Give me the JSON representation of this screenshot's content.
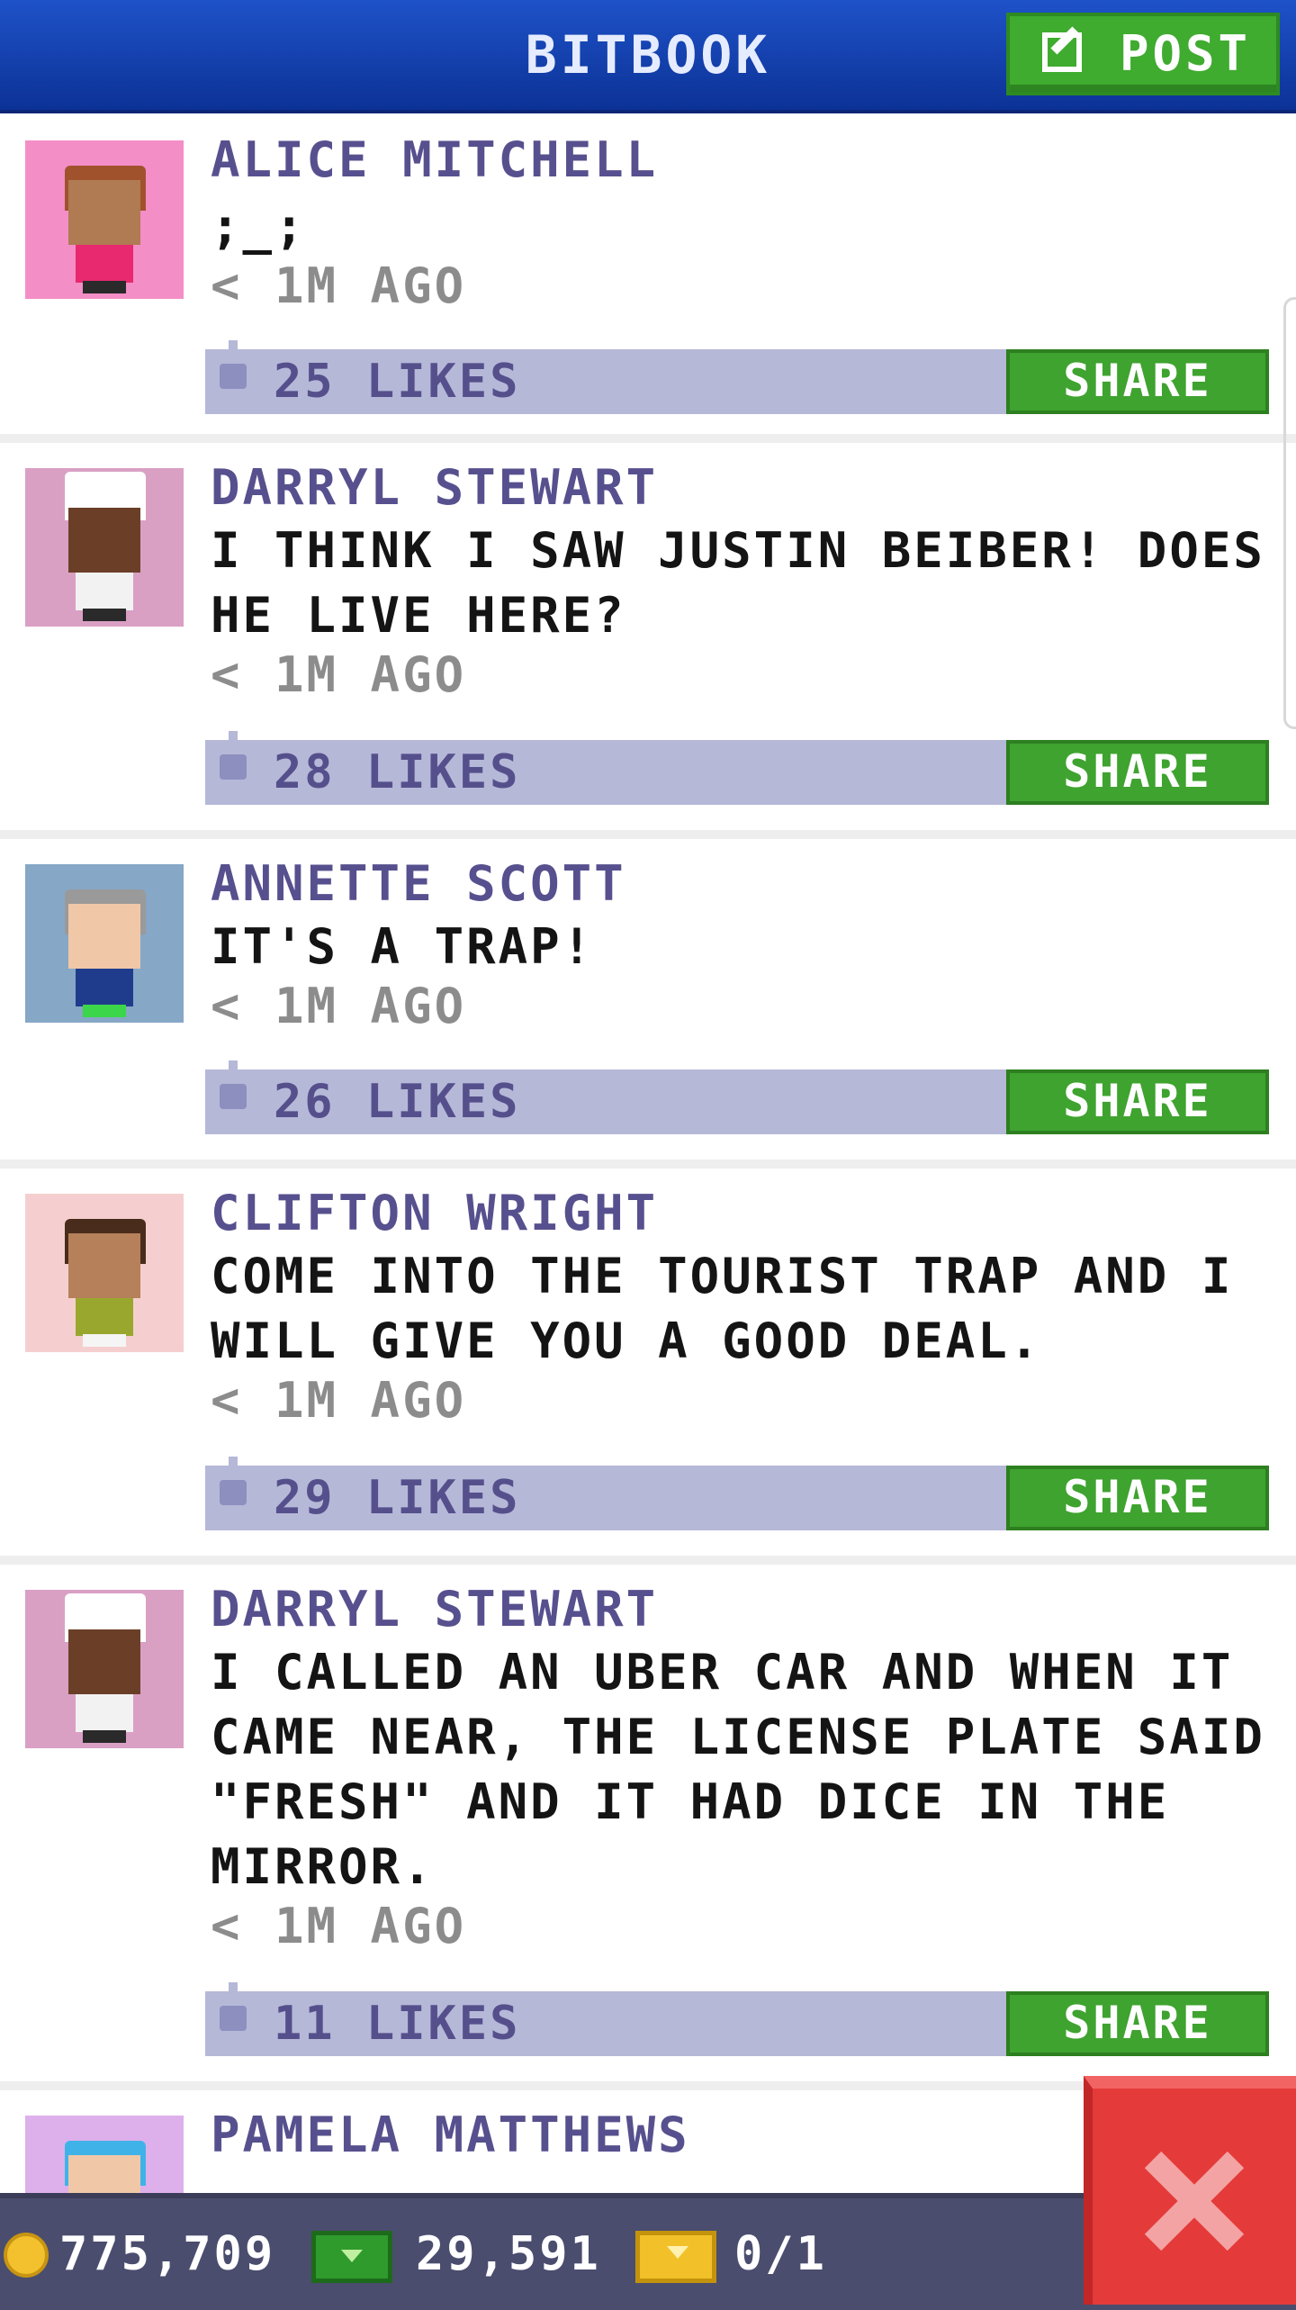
{
  "header": {
    "title": "BITBOOK",
    "post_label": "POST"
  },
  "posts": [
    {
      "name": "ALICE MITCHELL",
      "message": ";_;",
      "time": "< 1M AGO",
      "likes": "25 LIKES",
      "share_label": "SHARE",
      "avatar_bg": "#f48ec6",
      "skin": "#b07a52",
      "hair": "#a0522d",
      "shirt": "#e8296f"
    },
    {
      "name": "DARRYL STEWART",
      "message": "I THINK I SAW JUSTIN BEIBER! DOES HE LIVE HERE?",
      "time": "< 1M AGO",
      "likes": "28 LIKES",
      "share_label": "SHARE",
      "avatar_bg": "#d9a0c4",
      "skin": "#6b3f27",
      "hair": "#ffffff",
      "shirt": "#f2f2f2"
    },
    {
      "name": "ANNETTE SCOTT",
      "message": "IT'S A TRAP!",
      "time": "< 1M AGO",
      "likes": "26 LIKES",
      "share_label": "SHARE",
      "avatar_bg": "#86a7c6",
      "skin": "#f0c8a8",
      "hair": "#9a9a9a",
      "shirt": "#1f3c8c"
    },
    {
      "name": "CLIFTON WRIGHT",
      "message": "COME INTO THE TOURIST TRAP AND I WILL GIVE YOU A GOOD DEAL.",
      "time": "< 1M AGO",
      "likes": "29 LIKES",
      "share_label": "SHARE",
      "avatar_bg": "#f5cfcf",
      "skin": "#b5805a",
      "hair": "#4a2c1c",
      "shirt": "#9aa72f"
    },
    {
      "name": "DARRYL STEWART",
      "message": "I CALLED AN UBER CAR AND WHEN IT CAME NEAR, THE LICENSE PLATE SAID \"FRESH\" AND IT HAD DICE IN THE MIRROR.",
      "time": "< 1M AGO",
      "likes": "11 LIKES",
      "share_label": "SHARE",
      "avatar_bg": "#d9a0c4",
      "skin": "#6b3f27",
      "hair": "#ffffff",
      "shirt": "#f2f2f2"
    },
    {
      "name": "PAMELA MATTHEWS",
      "avatar_bg": "#ddb0ec",
      "skin": "#f0c8a8",
      "hair": "#3fb3e8",
      "shirt": "#7a4fb0"
    }
  ],
  "footer": {
    "coins": "775,709",
    "bux": "29,591",
    "tickets": "0/1"
  },
  "colors": {
    "header": "#1a4bbf",
    "accent_green": "#3fab2f",
    "like_bar": "#b6b8d8",
    "close": "#e53a3a"
  }
}
